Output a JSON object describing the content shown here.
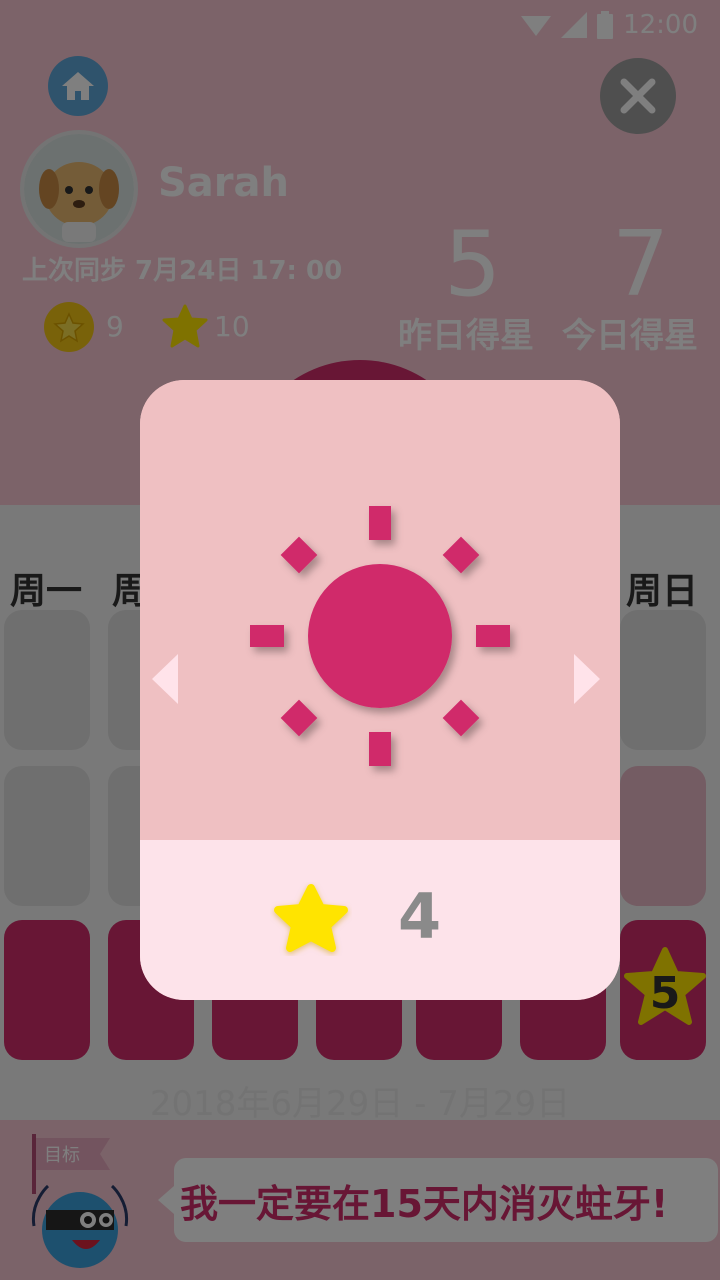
{
  "status": {
    "time": "12:00"
  },
  "profile": {
    "name": "Sarah",
    "last_sync": "上次同步 7月24日 17: 00",
    "coins": "9",
    "stars": "10"
  },
  "score": {
    "yesterday_value": "5",
    "yesterday_label": "昨日得星",
    "today_value": "7",
    "today_label": "今日得星"
  },
  "week": {
    "labels": {
      "mon": "周一",
      "tue": "周",
      "sun": "周日"
    },
    "sunday_star_count": "5"
  },
  "date_range": "2018年6月29日 - 7月29日",
  "goal": {
    "flag_label": "目标",
    "text": "我一定要在15天内消灭蛀牙!"
  },
  "modal": {
    "icon": "sun-icon",
    "star_count": "4"
  },
  "colors": {
    "accent_pink": "#d02c6a",
    "star_yellow": "#ffe400"
  }
}
